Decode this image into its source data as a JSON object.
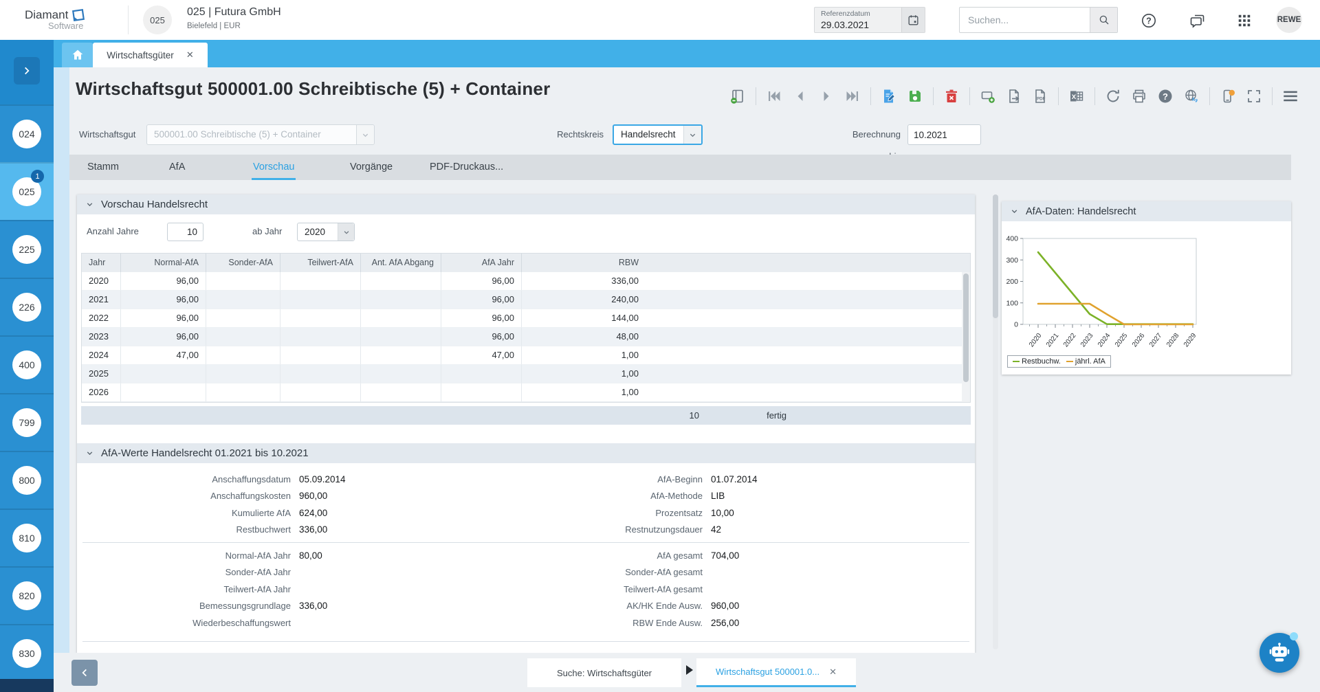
{
  "colors": {
    "accent_blue": "#41b0e8",
    "sidebar_blue": "#2a90d2",
    "active_item_blue": "#55b9ee",
    "chart_green": "#7cb228",
    "chart_orange": "#e0a22e",
    "save_green": "#4caf50",
    "delete_red": "#d84040"
  },
  "header": {
    "logo_line1": "Diamant",
    "logo_line2": "Software",
    "client_badge": "025",
    "company_title": "025 | Futura GmbH",
    "company_subtitle": "Bielefeld | EUR",
    "reference_date_label": "Referenzdatum",
    "reference_date_value": "29.03.2021",
    "search_placeholder": "Suchen...",
    "avatar_initials": "REWE",
    "icons": [
      "calendar-icon",
      "search-icon",
      "help-icon",
      "chat-icon",
      "apps-grid-icon"
    ]
  },
  "workspace_tabs": {
    "home_icon": "home-icon",
    "active_tab_label": "Wirtschaftsgüter"
  },
  "sidebar": {
    "expand_icon": "chevron-right-icon",
    "items": [
      {
        "label": "024"
      },
      {
        "label": "025",
        "badge": "1",
        "active": true
      },
      {
        "label": "225"
      },
      {
        "label": "226"
      },
      {
        "label": "400"
      },
      {
        "label": "799"
      },
      {
        "label": "800"
      },
      {
        "label": "810"
      },
      {
        "label": "820"
      },
      {
        "label": "830"
      }
    ]
  },
  "page": {
    "title": "Wirtschaftsgut 500001.00 Schreibtische (5) + Container",
    "toolbar_icons": [
      "detail-view",
      "first-record",
      "previous-record",
      "next-record",
      "last-record",
      "edit-document",
      "save",
      "delete",
      "add-window",
      "export-document",
      "pdf-document",
      "excel-export",
      "refresh",
      "print",
      "help-filled",
      "web-link",
      "phone-notification",
      "fullscreen",
      "menu"
    ],
    "fields": {
      "wirtschaftsgut_label": "Wirtschaftsgut",
      "wirtschaftsgut_value": "500001.00 Schreibtische (5) + Container",
      "rechtskreis_label": "Rechtskreis",
      "rechtskreis_value": "Handelsrecht",
      "berechnung_label": "Berechnung bis",
      "berechnung_value": "10.2021"
    },
    "tabs": [
      "Stamm",
      "AfA",
      "Vorschau",
      "Vorgänge",
      "PDF-Druckaus..."
    ],
    "active_tab": "Vorschau"
  },
  "vorschau": {
    "section_title": "Vorschau Handelsrecht",
    "anzahl_jahre_label": "Anzahl Jahre",
    "anzahl_jahre_value": "10",
    "ab_jahr_label": "ab Jahr",
    "ab_jahr_value": "2020",
    "table": {
      "columns": [
        "Jahr",
        "Normal-AfA",
        "Sonder-AfA",
        "Teilwert-AfA",
        "Ant. AfA Abgang",
        "AfA Jahr",
        "RBW"
      ],
      "rows": [
        [
          "2020",
          "96,00",
          "",
          "",
          "",
          "96,00",
          "336,00"
        ],
        [
          "2021",
          "96,00",
          "",
          "",
          "",
          "96,00",
          "240,00"
        ],
        [
          "2022",
          "96,00",
          "",
          "",
          "",
          "96,00",
          "144,00"
        ],
        [
          "2023",
          "96,00",
          "",
          "",
          "",
          "96,00",
          "48,00"
        ],
        [
          "2024",
          "47,00",
          "",
          "",
          "",
          "47,00",
          "1,00"
        ],
        [
          "2025",
          "",
          "",
          "",
          "",
          "",
          "1,00"
        ],
        [
          "2026",
          "",
          "",
          "",
          "",
          "",
          "1,00"
        ]
      ],
      "footer_count": "10",
      "footer_status": "fertig"
    }
  },
  "afa_werte": {
    "section_title": "AfA-Werte Handelsrecht 01.2021 bis 10.2021",
    "block1_left": [
      {
        "label": "Anschaffungsdatum",
        "value": "05.09.2014"
      },
      {
        "label": "Anschaffungskosten",
        "value": "960,00"
      },
      {
        "label": "Kumulierte AfA",
        "value": "624,00"
      },
      {
        "label": "Restbuchwert",
        "value": "336,00"
      }
    ],
    "block1_right": [
      {
        "label": "AfA-Beginn",
        "value": "01.07.2014"
      },
      {
        "label": "AfA-Methode",
        "value": "LIB"
      },
      {
        "label": "Prozentsatz",
        "value": "10,00"
      },
      {
        "label": "Restnutzungsdauer",
        "value": "42"
      }
    ],
    "block2_left": [
      {
        "label": "Normal-AfA Jahr",
        "value": "80,00"
      },
      {
        "label": "Sonder-AfA Jahr",
        "value": ""
      },
      {
        "label": "Teilwert-AfA Jahr",
        "value": ""
      },
      {
        "label": "Bemessungsgrundlage",
        "value": "336,00"
      },
      {
        "label": "Wiederbeschaffungswert",
        "value": ""
      }
    ],
    "block2_right": [
      {
        "label": "AfA gesamt",
        "value": "704,00"
      },
      {
        "label": "Sonder-AfA gesamt",
        "value": ""
      },
      {
        "label": "Teilwert-AfA gesamt",
        "value": ""
      },
      {
        "label": "AK/HK Ende Ausw.",
        "value": "960,00"
      },
      {
        "label": "RBW Ende Ausw.",
        "value": "256,00"
      }
    ]
  },
  "chart_panel": {
    "section_title": "AfA-Daten: Handelsrecht"
  },
  "chart_data": {
    "type": "line",
    "title": "AfA-Daten: Handelsrecht",
    "x": [
      "2020",
      "2021",
      "2022",
      "2023",
      "2024",
      "2025",
      "2026",
      "2027",
      "2028",
      "2029"
    ],
    "series": [
      {
        "name": "Restbuchw.",
        "color": "#7cb228",
        "values": [
          336,
          240,
          144,
          48,
          1,
          1,
          1,
          1,
          1,
          1
        ]
      },
      {
        "name": "jährl. AfA",
        "color": "#e0a22e",
        "values": [
          96,
          96,
          96,
          96,
          47,
          0,
          0,
          0,
          0,
          0
        ]
      }
    ],
    "xlabel": "",
    "ylabel": "",
    "ylim": [
      0,
      400
    ],
    "yticks": [
      0,
      100,
      200,
      300,
      400
    ],
    "legend_position": "bottom-left",
    "grid": false
  },
  "bottom_bar": {
    "back_icon": "chevron-left-icon",
    "forward_icon": "play-icon",
    "tab_search_label": "Suche: Wirtschaftsgüter",
    "tab_record_label": "Wirtschaftsgut 500001.0...",
    "assistant_icon": "robot-icon"
  }
}
